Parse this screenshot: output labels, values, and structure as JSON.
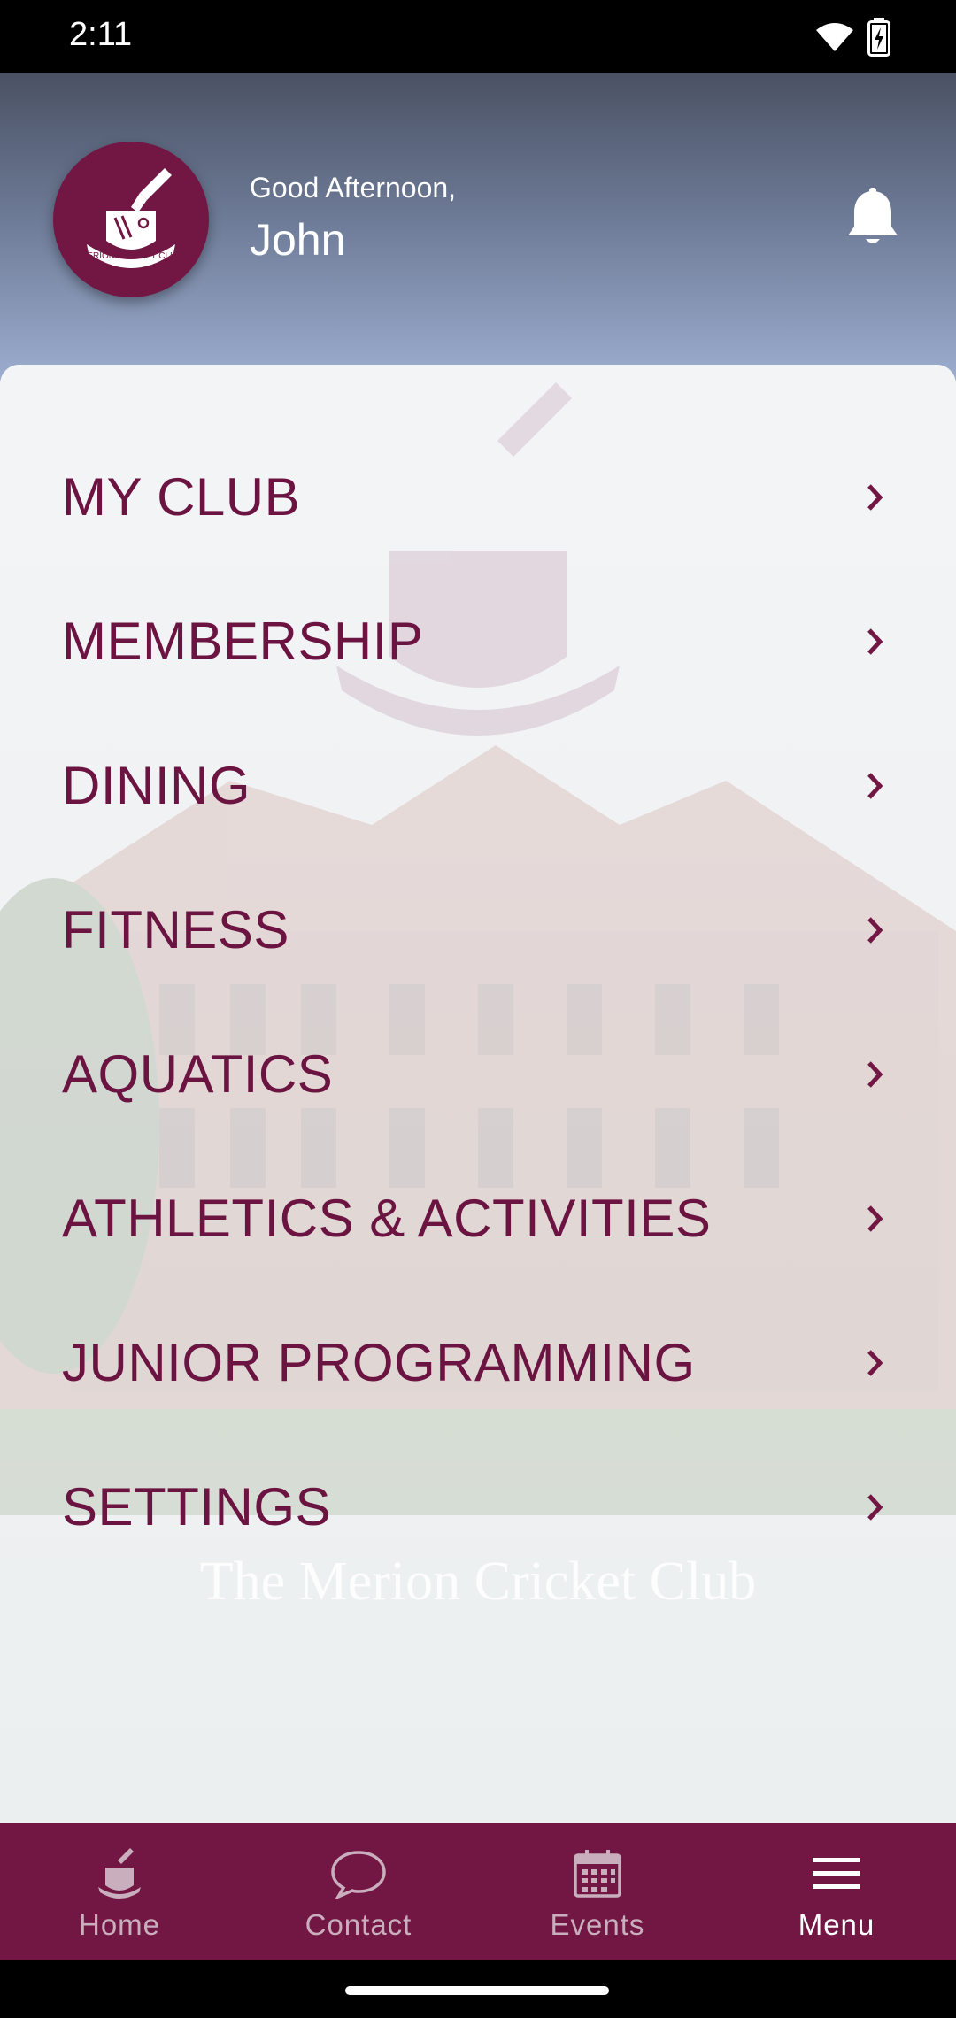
{
  "status_bar": {
    "time": "2:11"
  },
  "header": {
    "greeting": "Good Afternoon,",
    "user_name": "John",
    "logo_text": "MERION CRICKET CLUB"
  },
  "menu": {
    "items": [
      {
        "label": "MY CLUB"
      },
      {
        "label": "MEMBERSHIP"
      },
      {
        "label": "DINING"
      },
      {
        "label": "FITNESS"
      },
      {
        "label": "AQUATICS"
      },
      {
        "label": "ATHLETICS & ACTIVITIES"
      },
      {
        "label": "JUNIOR PROGRAMMING"
      },
      {
        "label": "SETTINGS"
      }
    ],
    "background_caption": "The Merion Cricket Club"
  },
  "bottom_nav": {
    "items": [
      {
        "label": "Home",
        "icon": "club-logo-icon",
        "active": false
      },
      {
        "label": "Contact",
        "icon": "chat-bubble-icon",
        "active": false
      },
      {
        "label": "Events",
        "icon": "calendar-icon",
        "active": false
      },
      {
        "label": "Menu",
        "icon": "hamburger-menu-icon",
        "active": true
      }
    ]
  },
  "colors": {
    "brand": "#721643",
    "menu_text": "#6b1441",
    "nav_inactive": "#c9aebd",
    "nav_active": "#ffffff"
  }
}
